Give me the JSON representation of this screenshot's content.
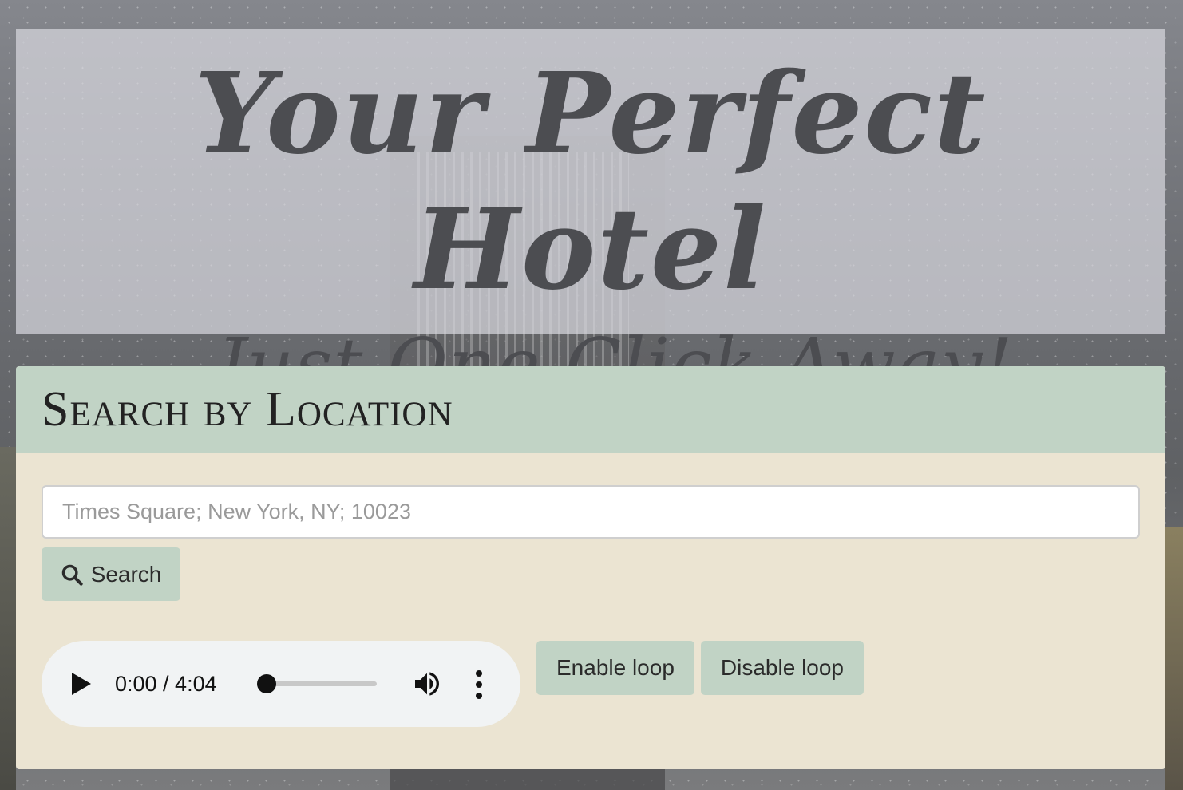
{
  "hero": {
    "title": "Your Perfect Hotel",
    "subtitle": "..Just One Click Away!"
  },
  "search_panel": {
    "title": "Search by Location",
    "input_placeholder": "Times Square; New York, NY; 10023",
    "input_value": "",
    "search_button_label": "Search",
    "search_icon": "search-icon"
  },
  "audio": {
    "current_time": "0:00",
    "duration": "4:04",
    "time_display": "0:00 / 4:04",
    "progress": 0,
    "icons": [
      "play-icon",
      "volume-icon",
      "more-options-icon"
    ]
  },
  "loop_controls": {
    "enable_label": "Enable loop",
    "disable_label": "Disable loop"
  },
  "colors": {
    "panel_header": "#c1d3c5",
    "panel_body": "#ebe4d2",
    "button": "#c1d3c5",
    "hero_text": "#4c4d51"
  }
}
